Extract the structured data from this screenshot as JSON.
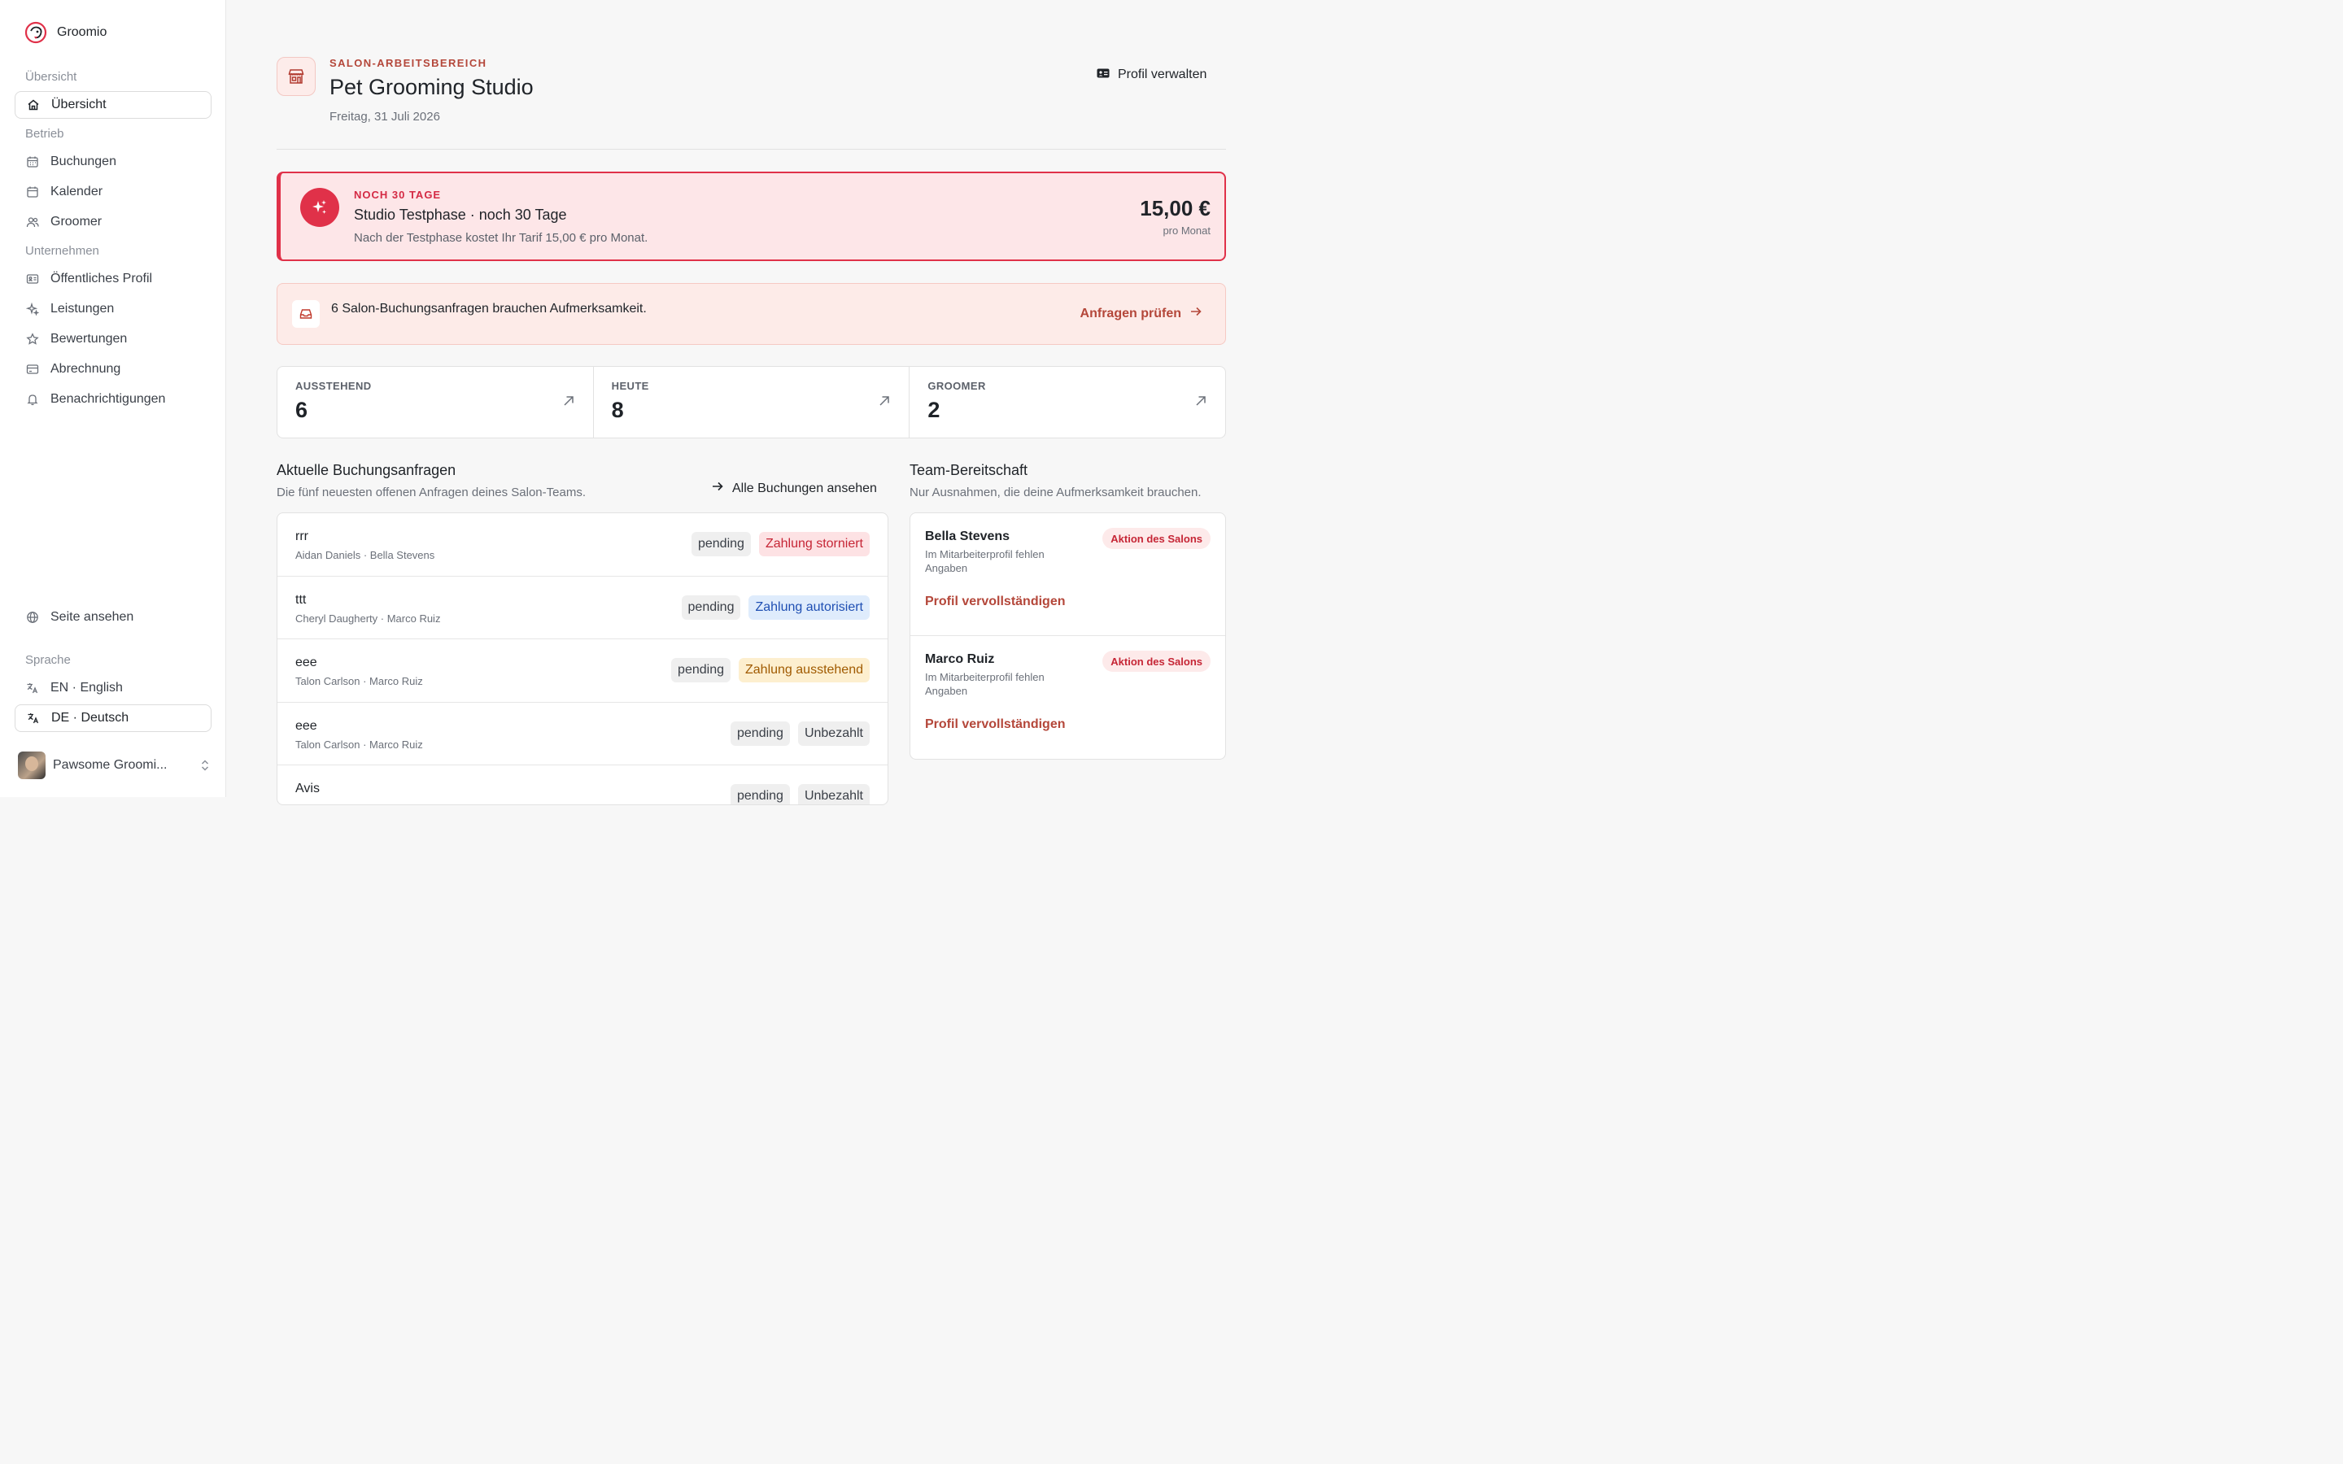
{
  "app": {
    "name": "Groomio"
  },
  "sidebar": {
    "sections": {
      "overview": "Übersicht",
      "operations": "Betrieb",
      "company": "Unternehmen",
      "language": "Sprache"
    },
    "items": [
      {
        "label": "Übersicht",
        "icon": "home-icon",
        "active": true
      },
      {
        "label": "Buchungen",
        "icon": "calendar-list-icon"
      },
      {
        "label": "Kalender",
        "icon": "calendar-icon"
      },
      {
        "label": "Groomer",
        "icon": "users-icon"
      },
      {
        "label": "Öffentliches Profil",
        "icon": "id-card-icon"
      },
      {
        "label": "Leistungen",
        "icon": "sparkles-icon"
      },
      {
        "label": "Bewertungen",
        "icon": "star-icon"
      },
      {
        "label": "Abrechnung",
        "icon": "credit-card-icon"
      },
      {
        "label": "Benachrichtigungen",
        "icon": "bell-icon"
      }
    ],
    "view_site": "Seite ansehen",
    "languages": [
      {
        "label": "EN · English",
        "active": false
      },
      {
        "label": "DE · Deutsch",
        "active": true
      }
    ],
    "user": {
      "name": "Pawsome Groomi..."
    }
  },
  "header": {
    "eyebrow": "SALON-ARBEITSBEREICH",
    "title": "Pet Grooming Studio",
    "date": "Freitag, 31 Juli 2026",
    "profile_button": "Profil verwalten"
  },
  "trial": {
    "eyebrow": "NOCH 30 TAGE",
    "title": "Studio Testphase · noch 30 Tage",
    "description": "Nach der Testphase kostet Ihr Tarif 15,00 € pro Monat.",
    "price": "15,00 €",
    "period": "pro Monat",
    "accent": "#e03149"
  },
  "alert": {
    "text": "6 Salon-Buchungsanfragen brauchen Aufmerksamkeit.",
    "link": "Anfragen prüfen"
  },
  "stats": [
    {
      "label": "AUSSTEHEND",
      "value": "6"
    },
    {
      "label": "HEUTE",
      "value": "8"
    },
    {
      "label": "GROOMER",
      "value": "2"
    }
  ],
  "bookings": {
    "title": "Aktuelle Buchungsanfragen",
    "subtitle": "Die fünf neuesten offenen Anfragen deines Salon-Teams.",
    "all_link": "Alle Buchungen ansehen",
    "rows": [
      {
        "name": "rrr",
        "people": "Aidan Daniels · Bella Stevens",
        "status": "pending",
        "payment": "Zahlung storniert",
        "payment_tone": "red"
      },
      {
        "name": "ttt",
        "people": "Cheryl Daugherty · Marco Ruiz",
        "status": "pending",
        "payment": "Zahlung autorisiert",
        "payment_tone": "blue"
      },
      {
        "name": "eee",
        "people": "Talon Carlson · Marco Ruiz",
        "status": "pending",
        "payment": "Zahlung ausstehend",
        "payment_tone": "amber"
      },
      {
        "name": "eee",
        "people": "Talon Carlson · Marco Ruiz",
        "status": "pending",
        "payment": "Unbezahlt",
        "payment_tone": "gray"
      },
      {
        "name": "Avis",
        "people": "",
        "status": "pending",
        "payment": "Unbezahlt",
        "payment_tone": "gray"
      }
    ]
  },
  "team": {
    "title": "Team-Bereitschaft",
    "subtitle": "Nur Ausnahmen, die deine Aufmerksamkeit brauchen.",
    "members": [
      {
        "name": "Bella Stevens",
        "note": "Im Mitarbeiterprofil fehlen Angaben",
        "badge": "Aktion des Salons",
        "link": "Profil vervollständigen"
      },
      {
        "name": "Marco Ruiz",
        "note": "Im Mitarbeiterprofil fehlen Angaben",
        "badge": "Aktion des Salons",
        "link": "Profil vervollständigen"
      }
    ]
  }
}
